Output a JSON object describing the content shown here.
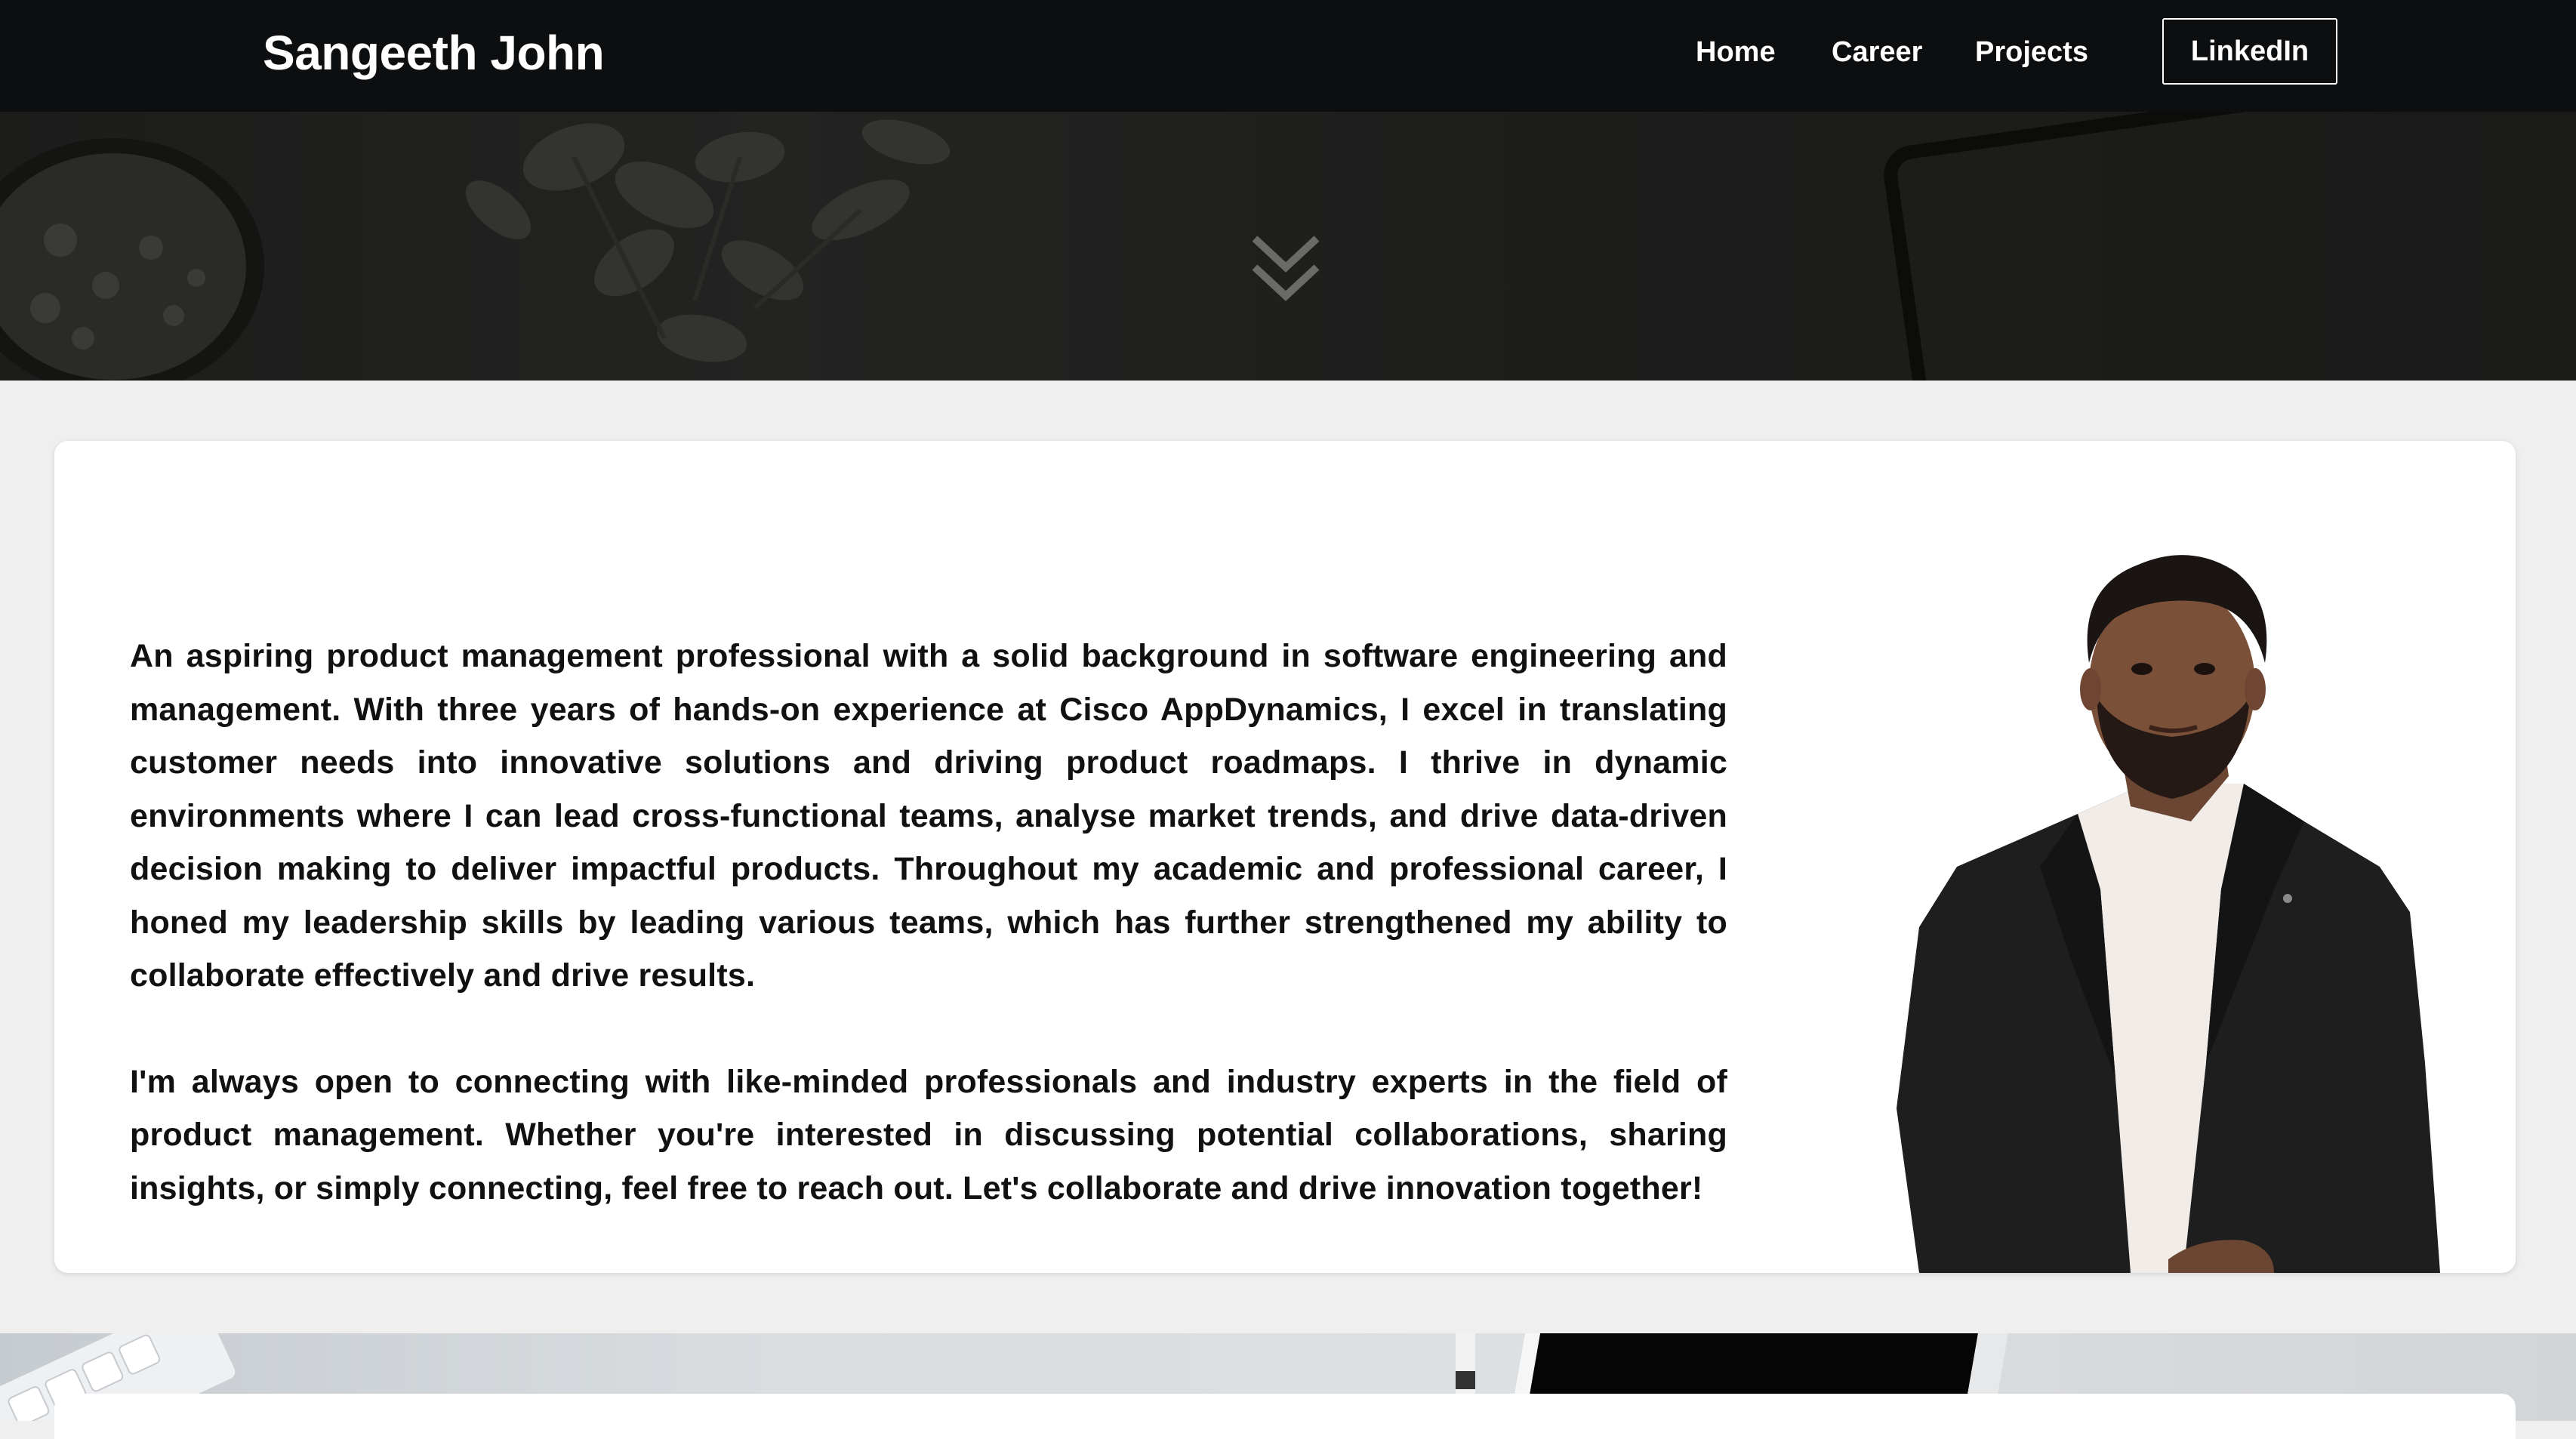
{
  "header": {
    "brand": "Sangeeth John",
    "nav": {
      "home": "Home",
      "career": "Career",
      "projects": "Projects",
      "linkedin": "LinkedIn"
    }
  },
  "hero": {
    "scroll_icon": "double-chevron-down-icon"
  },
  "about": {
    "paragraph_1": "An aspiring product management professional with a solid background in software engineering and management. With three years of hands-on experience at Cisco AppDynamics, I excel in translating customer needs into innovative solutions and driving product roadmaps. I thrive in dynamic environments where I can lead cross-functional teams, analyse market trends, and drive data-driven decision making to deliver impactful products. Throughout my academic and professional career, I honed my leadership skills by leading various teams, which has further strengthened my ability to collaborate effectively and drive results.",
    "paragraph_2": "I'm always open to connecting with like-minded professionals and industry experts in the field of product management. Whether you're interested in discussing potential collaborations, sharing insights, or simply connecting, feel free to reach out. Let's collaborate and drive innovation together!"
  },
  "colors": {
    "nav_background": "#0d0e10",
    "page_background": "#efefef",
    "card_background": "#ffffff",
    "text": "#111111"
  }
}
